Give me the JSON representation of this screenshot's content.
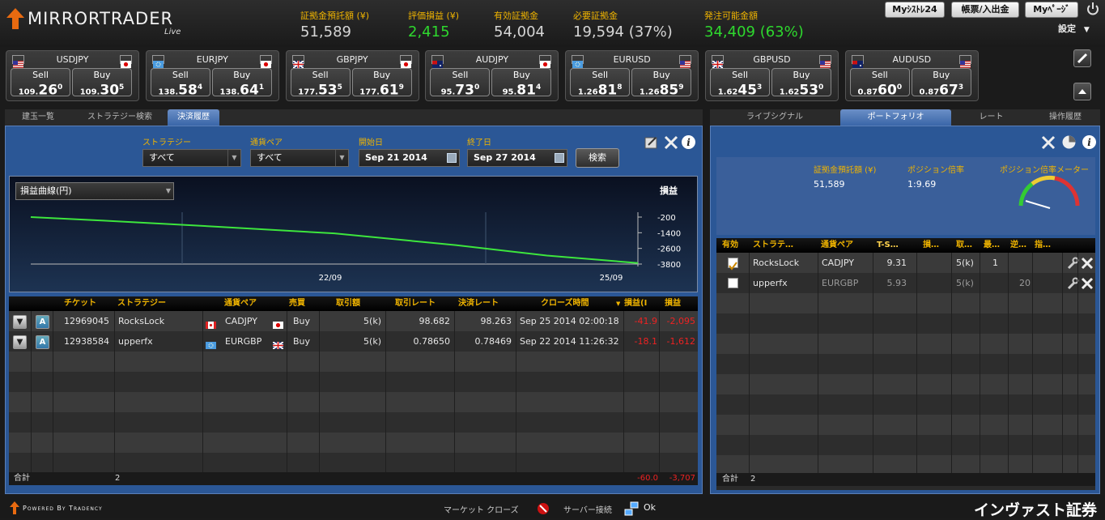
{
  "app": {
    "logo": "MIRRORTRADER",
    "logo_sub": "Live"
  },
  "summary": [
    {
      "label": "証拠金預託額 (¥)",
      "value": "51,589",
      "green": false
    },
    {
      "label": "評価損益 (¥)",
      "value": "2,415",
      "green": true
    },
    {
      "label": "有効証拠金",
      "value": "54,004",
      "green": false
    },
    {
      "label": "必要証拠金",
      "value": "19,594 (37%)",
      "green": false
    },
    {
      "label": "発注可能金額",
      "value": "34,409 (63%)",
      "green": true
    }
  ],
  "header_buttons": {
    "my_system": "Myｼｽﾄﾚ24",
    "deposit": "帳票/入出金",
    "my_page": "Myﾍﾟｰｼﾞ",
    "settings": "設定"
  },
  "rates": [
    {
      "pair": "USDJPY",
      "sell_label": "Sell",
      "buy_label": "Buy",
      "sell_pre": "109.",
      "sell_big": "26",
      "sell_pip": "0",
      "buy_pre": "109.",
      "buy_big": "30",
      "buy_pip": "5"
    },
    {
      "pair": "EURJPY",
      "sell_label": "Sell",
      "buy_label": "Buy",
      "sell_pre": "138.",
      "sell_big": "58",
      "sell_pip": "4",
      "buy_pre": "138.",
      "buy_big": "64",
      "buy_pip": "1"
    },
    {
      "pair": "GBPJPY",
      "sell_label": "Sell",
      "buy_label": "Buy",
      "sell_pre": "177.",
      "sell_big": "53",
      "sell_pip": "5",
      "buy_pre": "177.",
      "buy_big": "61",
      "buy_pip": "9"
    },
    {
      "pair": "AUDJPY",
      "sell_label": "Sell",
      "buy_label": "Buy",
      "sell_pre": "95.",
      "sell_big": "73",
      "sell_pip": "0",
      "buy_pre": "95.",
      "buy_big": "81",
      "buy_pip": "4"
    },
    {
      "pair": "EURUSD",
      "sell_label": "Sell",
      "buy_label": "Buy",
      "sell_pre": "1.26",
      "sell_big": "81",
      "sell_pip": "8",
      "buy_pre": "1.26",
      "buy_big": "85",
      "buy_pip": "9"
    },
    {
      "pair": "GBPUSD",
      "sell_label": "Sell",
      "buy_label": "Buy",
      "sell_pre": "1.62",
      "sell_big": "45",
      "sell_pip": "3",
      "buy_pre": "1.62",
      "buy_big": "53",
      "buy_pip": "0"
    },
    {
      "pair": "AUDUSD",
      "sell_label": "Sell",
      "buy_label": "Buy",
      "sell_pre": "0.87",
      "sell_big": "60",
      "sell_pip": "0",
      "buy_pre": "0.87",
      "buy_big": "67",
      "buy_pip": "3"
    }
  ],
  "left_tabs": [
    "建玉一覧",
    "ストラテジー検索",
    "決済履歴"
  ],
  "filters": {
    "strategy_label": "ストラテジー",
    "strategy_value": "すべて",
    "pair_label": "通貨ペア",
    "pair_value": "すべて",
    "start_label": "開始日",
    "start_value": "Sep 21 2014",
    "end_label": "終了日",
    "end_value": "Sep 27 2014",
    "search": "検索"
  },
  "chart_data": {
    "type": "line",
    "selector": "損益曲線(円)",
    "ylabel": "損益",
    "yticks": [
      "-200",
      "-1400",
      "-2600",
      "-3800"
    ],
    "xticks": [
      "22/09",
      "25/09"
    ],
    "ylim": [
      -3800,
      -200
    ],
    "series": [
      {
        "points": [
          [
            0,
            -200
          ],
          [
            0.12,
            -470
          ],
          [
            0.3,
            -920
          ],
          [
            0.5,
            -1450
          ],
          [
            0.7,
            -2350
          ],
          [
            0.85,
            -3150
          ],
          [
            1.0,
            -3720
          ]
        ]
      }
    ]
  },
  "history_grid": {
    "columns": [
      "チケット",
      "ストラテジー",
      "通貨ペア",
      "売買",
      "取引額",
      "取引レート",
      "決済レート",
      "クローズ時間",
      "損益(I",
      "損益"
    ],
    "rows": [
      {
        "ticket": "12969045",
        "strategy": "RocksLock",
        "pair": "CADJPY",
        "side": "Buy",
        "amount": "5(k)",
        "rate": "98.682",
        "close_rate": "98.263",
        "close_time": "Sep 25 2014 02:00:18",
        "pl_pips": "-41.9",
        "pl": "-2,095"
      },
      {
        "ticket": "12938584",
        "strategy": "upperfx",
        "pair": "EURGBP",
        "side": "Buy",
        "amount": "5(k)",
        "rate": "0.78650",
        "close_rate": "0.78469",
        "close_time": "Sep 22 2014 11:26:32",
        "pl_pips": "-18.1",
        "pl": "-1,612"
      }
    ],
    "footer_label": "合計",
    "footer_count": "2",
    "footer_pips": "-60.0",
    "footer_pl": "-3,707"
  },
  "right_tabs": [
    "ライブシグナル",
    "ポートフォリオ",
    "レート",
    "操作履歴"
  ],
  "portfolio": {
    "margin_label": "証拠金預託額 (¥)",
    "margin_value": "51,589",
    "leverage_label": "ポジション倍率",
    "leverage_value": "1:9.69",
    "meter_label": "ポジション倍率メーター",
    "columns": [
      "有効",
      "ストラテ…",
      "通貨ペア",
      "T-S…",
      "損…",
      "取…",
      "最…",
      "逆…",
      "指…"
    ],
    "rows": [
      {
        "active": true,
        "strategy": "RocksLock",
        "pair": "CADJPY",
        "ts": "9.31",
        "amount": "5(k)",
        "max": "1",
        "rev": ""
      },
      {
        "active": false,
        "strategy": "upperfx",
        "pair": "EURGBP",
        "ts": "5.93",
        "amount": "5(k)",
        "max": "",
        "rev": "20"
      }
    ],
    "footer_label": "合計",
    "footer_count": "2"
  },
  "footer": {
    "powered": "Powered By Tradency",
    "market_label": "マーケット クローズ",
    "server_label": "サーバー接続",
    "server_status": "Ok",
    "broker": "インヴァスト証券"
  },
  "colors": {
    "accent": "#f0b400",
    "green": "#2ed82e",
    "red": "#e22222",
    "panel": "#2b5796"
  }
}
